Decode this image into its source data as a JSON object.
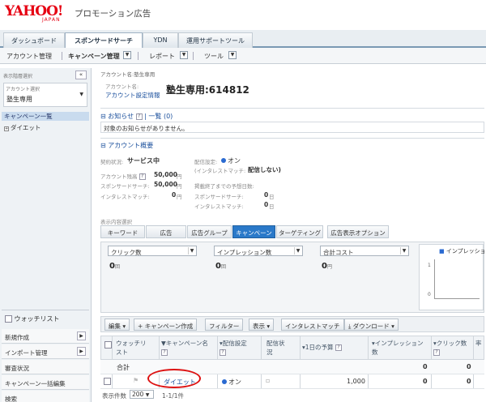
{
  "header": {
    "logo_text": "YAHOO!",
    "logo_sub": "JAPAN",
    "product": "プロモーション広告"
  },
  "main_tabs": [
    "ダッシュボード",
    "スポンサードサーチ",
    "YDN",
    "運用サポートツール"
  ],
  "subnav": {
    "account_mgmt": "アカウント管理",
    "campaign_mgmt": "キャンペーン管理",
    "report": "レポート",
    "tools": "ツール"
  },
  "left_panel": {
    "display_level_label": "表示階層選択",
    "collapse": "«",
    "account_select_label": "アカウント選択",
    "account_value": "塾生専用",
    "tree": [
      "キャンペーン一覧",
      "ダイエット"
    ],
    "watchlist_label": "ウォッチリスト",
    "buttons": [
      "新規作成",
      "インポート管理",
      "審査状況",
      "キャンペーン一括編集",
      "検索"
    ]
  },
  "account": {
    "top_label": "アカウント名:塾生専用",
    "name_label": "アカウント名:",
    "settings_link": "アカウント設定情報",
    "name_value": "塾生専用:614812"
  },
  "notice": {
    "title": "お知らせ",
    "list_link": "一覧 (0)",
    "message": "対象のお知らせがありません。"
  },
  "overview": {
    "title": "アカウント概要",
    "contract_label": "契約状況:",
    "contract_value": "サービス中",
    "delivery_label": "配信設定:",
    "delivery_value": "オン",
    "interest_label": "(インタレストマッチ:",
    "interest_value": "配信しない)",
    "budget_label": "アカウント残高",
    "budget_value": "50,000",
    "sponsored_label": "スポンサードサーチ:",
    "sponsored_value": "50,000",
    "im_label": "インタレストマッチ:",
    "im_value": "0",
    "yen": "円",
    "end_label": "掲載終了までの予想日数:",
    "end_ss_label": "スポンサードサーチ:",
    "end_ss_value": "0",
    "end_im_label": "インタレストマッチ:",
    "end_im_value": "0",
    "day": "日"
  },
  "content": {
    "display_label": "表示内容選択",
    "tabs": [
      "キーワード",
      "広告",
      "広告グループ",
      "キャンペーン",
      "ターゲティング",
      "広告表示オプション"
    ],
    "graph_selects": [
      "クリック数",
      "インプレッション数",
      "合計コスト"
    ],
    "graph_values": [
      "0",
      "0",
      "0"
    ],
    "graph_units": [
      "回",
      "回",
      "円"
    ],
    "graph_legend": "インプレッショ",
    "axis_ticks": [
      "1",
      "0"
    ]
  },
  "toolbar": {
    "edit": "編集",
    "create_campaign": "キャンペーン作成",
    "filter": "フィルター",
    "display": "表示",
    "interest_match": "インタレストマッチ",
    "download": "ダウンロード"
  },
  "table": {
    "headers": [
      "ウォッチリスト",
      "キャンペーン名",
      "配信設定",
      "配信状況",
      "1日の予算",
      "インプレッション数",
      "クリック数",
      "率"
    ],
    "total_label": "合計",
    "total_impressions": "0",
    "total_clicks": "0",
    "row": {
      "name": "ダイエット",
      "delivery": "オン",
      "budget": "1,000",
      "impressions": "0",
      "clicks": "0"
    }
  },
  "pager": {
    "count_label": "表示件数",
    "count_value": "200",
    "range": "1-1/1件"
  },
  "colors": {
    "yahoo_red": "#e60012",
    "active_tab": "#2a79c9",
    "link": "#1a4f9c"
  }
}
